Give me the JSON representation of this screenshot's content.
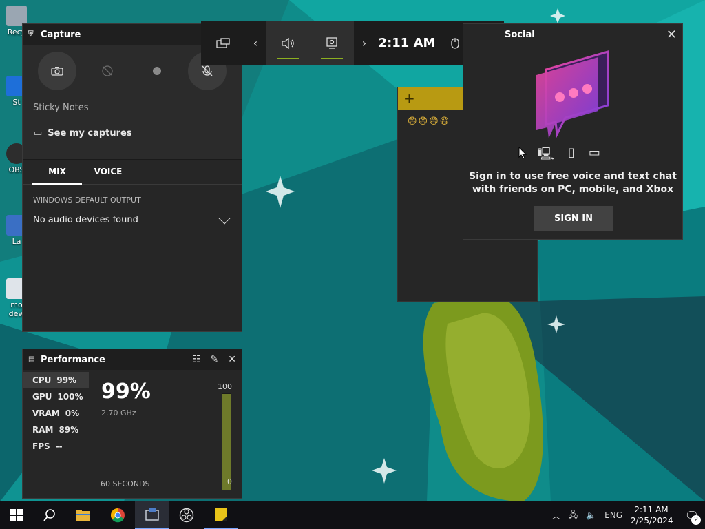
{
  "desktop": {
    "icons": [
      {
        "label": "Recy",
        "color": "#9aa6b2"
      },
      {
        "label": "St",
        "color": "#1e6fd9"
      },
      {
        "label": "OBS",
        "color": "#2d2d2d"
      },
      {
        "label": "La",
        "color": "#3a6fc4"
      },
      {
        "label": "mo dew",
        "color": "#dfe4ea"
      }
    ]
  },
  "topbar": {
    "widgets_icon": "widget-menu-icon",
    "time": "2:11 AM"
  },
  "capture": {
    "title": "Capture",
    "sticky_label": "Sticky Notes",
    "see_captures": "See my captures",
    "tabs": [
      "MIX",
      "VOICE"
    ],
    "output_label": "WINDOWS DEFAULT OUTPUT",
    "output_value": "No audio devices found"
  },
  "performance": {
    "title": "Performance",
    "rows": [
      {
        "label": "CPU",
        "value": "99%"
      },
      {
        "label": "GPU",
        "value": "100%"
      },
      {
        "label": "VRAM",
        "value": "0%"
      },
      {
        "label": "RAM",
        "value": "89%"
      },
      {
        "label": "FPS",
        "value": "--"
      }
    ],
    "big_value": "99%",
    "frequency": "2.70 GHz",
    "graph_max": "100",
    "graph_min": "0",
    "graph_level": 0.99,
    "duration": "60 SECONDS"
  },
  "sticky_notes": {
    "add": "+",
    "content": "😄😄😄😄"
  },
  "social": {
    "title": "Social",
    "message": "Sign in to use free voice and text chat with friends on PC, mobile, and Xbox",
    "sign_in": "SIGN IN"
  },
  "taskbar": {
    "lang": "ENG",
    "time": "2:11 AM",
    "date": "2/25/2024",
    "notifications": "2"
  },
  "colors": {
    "accent_green": "#8cb020",
    "sticky_yellow": "#b89a12",
    "chat_pink": "#e8459a",
    "chat_purple": "#7a3fe0"
  }
}
